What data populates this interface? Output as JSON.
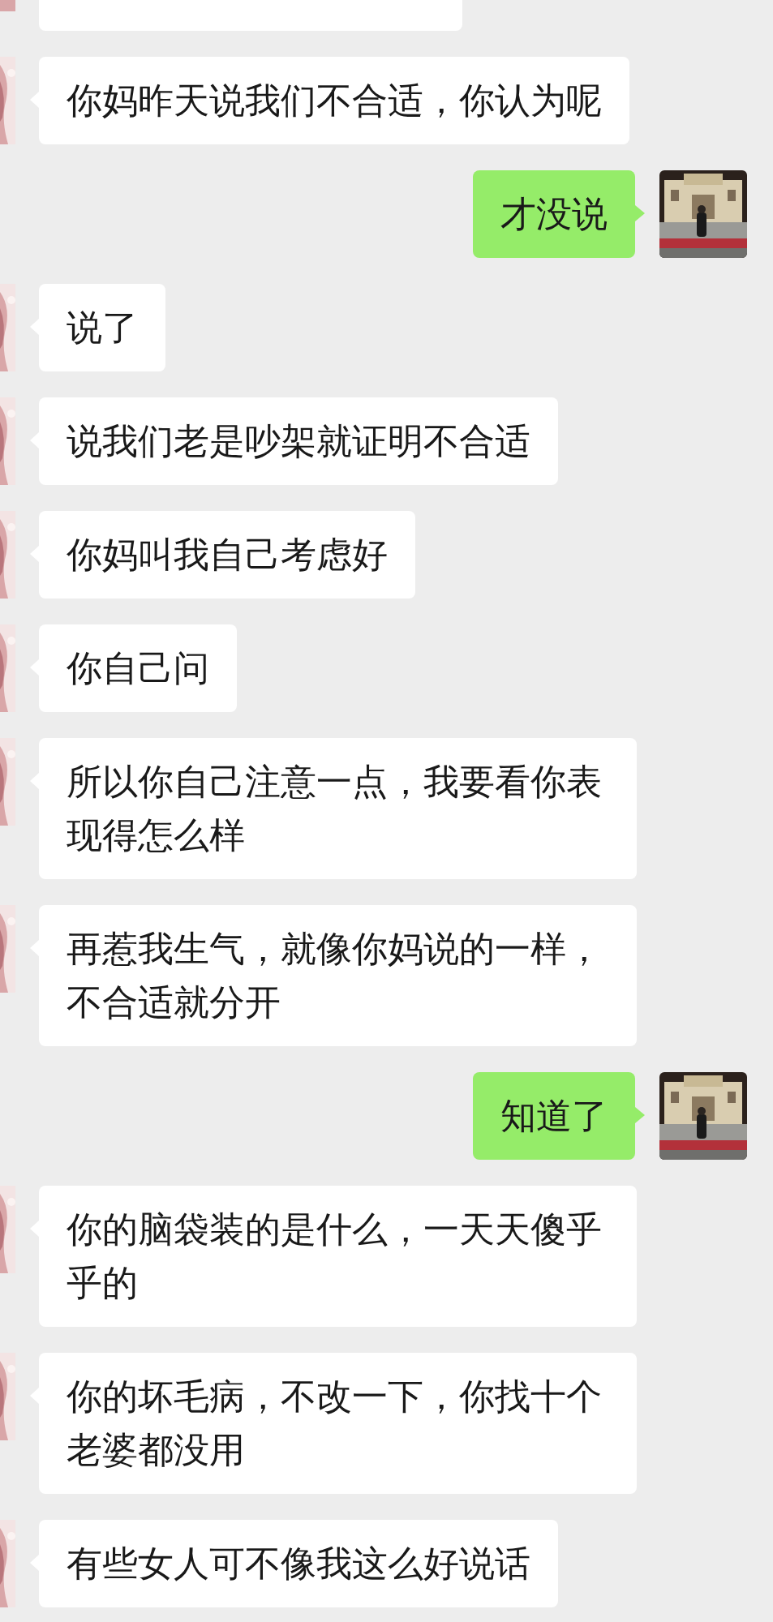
{
  "messages": [
    {
      "outgoing": false,
      "kind": "partial"
    },
    {
      "outgoing": false,
      "kind": "text",
      "text": "你妈昨天说我们不合适，你认为呢"
    },
    {
      "outgoing": true,
      "kind": "text",
      "text": "才没说"
    },
    {
      "outgoing": false,
      "kind": "text",
      "text": "说了"
    },
    {
      "outgoing": false,
      "kind": "text",
      "text": "说我们老是吵架就证明不合适"
    },
    {
      "outgoing": false,
      "kind": "text",
      "text": "你妈叫我自己考虑好"
    },
    {
      "outgoing": false,
      "kind": "text",
      "text": "你自己问"
    },
    {
      "outgoing": false,
      "kind": "text",
      "text": "所以你自己注意一点，我要看你表现得怎么样"
    },
    {
      "outgoing": false,
      "kind": "text",
      "text": "再惹我生气，就像你妈说的一样，不合适就分开"
    },
    {
      "outgoing": true,
      "kind": "text",
      "text": "知道了"
    },
    {
      "outgoing": false,
      "kind": "text",
      "text": "你的脑袋装的是什么，一天天傻乎乎的"
    },
    {
      "outgoing": false,
      "kind": "text",
      "text": "你的坏毛病，不改一下，你找十个老婆都没用"
    },
    {
      "outgoing": false,
      "kind": "text",
      "text": "有些女人可不像我这么好说话"
    }
  ]
}
